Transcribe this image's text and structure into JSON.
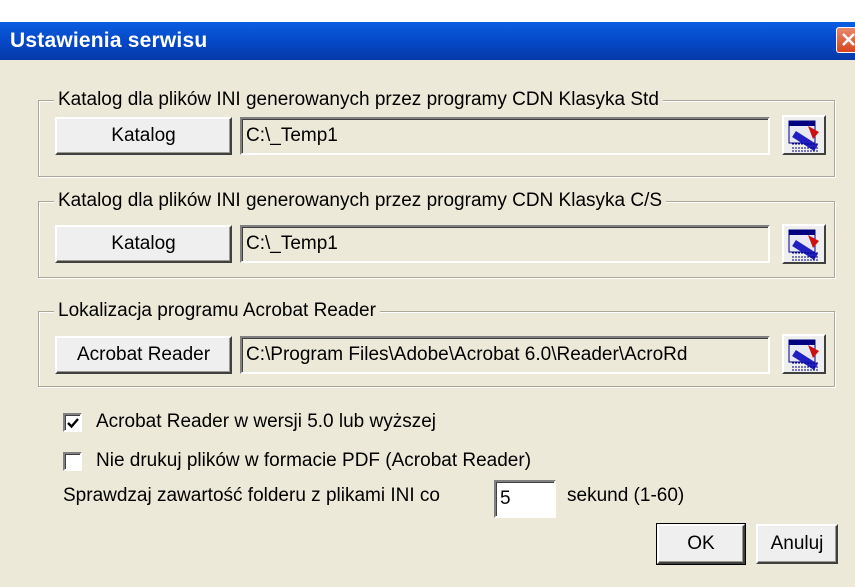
{
  "window": {
    "title": "Ustawienia serwisu"
  },
  "groups": [
    {
      "legend": "Katalog dla plików INI generowanych przez programy CDN Klasyka Std",
      "button_label": "Katalog",
      "path": "C:\\_Temp1",
      "icon": "browse-folder-icon"
    },
    {
      "legend": "Katalog dla plików INI generowanych przez programy CDN Klasyka C/S",
      "button_label": "Katalog",
      "path": "C:\\_Temp1",
      "icon": "browse-folder-icon"
    },
    {
      "legend": "Lokalizacja programu Acrobat Reader",
      "button_label": "Acrobat Reader",
      "path": "C:\\Program Files\\Adobe\\Acrobat 6.0\\Reader\\AcroRd",
      "icon": "browse-folder-icon"
    }
  ],
  "options": {
    "acrobat5": {
      "label": "Acrobat Reader w wersji 5.0 lub wyższej",
      "checked": true
    },
    "no_print_pdf": {
      "label": "Nie drukuj plików w formacie PDF (Acrobat Reader)",
      "checked": false
    }
  },
  "interval": {
    "label_before": "Sprawdzaj zawartość folderu z plikami INI co",
    "value": "5",
    "label_after": "sekund (1-60)"
  },
  "buttons": {
    "ok": "OK",
    "cancel": "Anuluj"
  },
  "colors": {
    "titlebar": "#0548c8",
    "dialog_bg": "#ece9d8",
    "close_button": "#d6451f"
  }
}
